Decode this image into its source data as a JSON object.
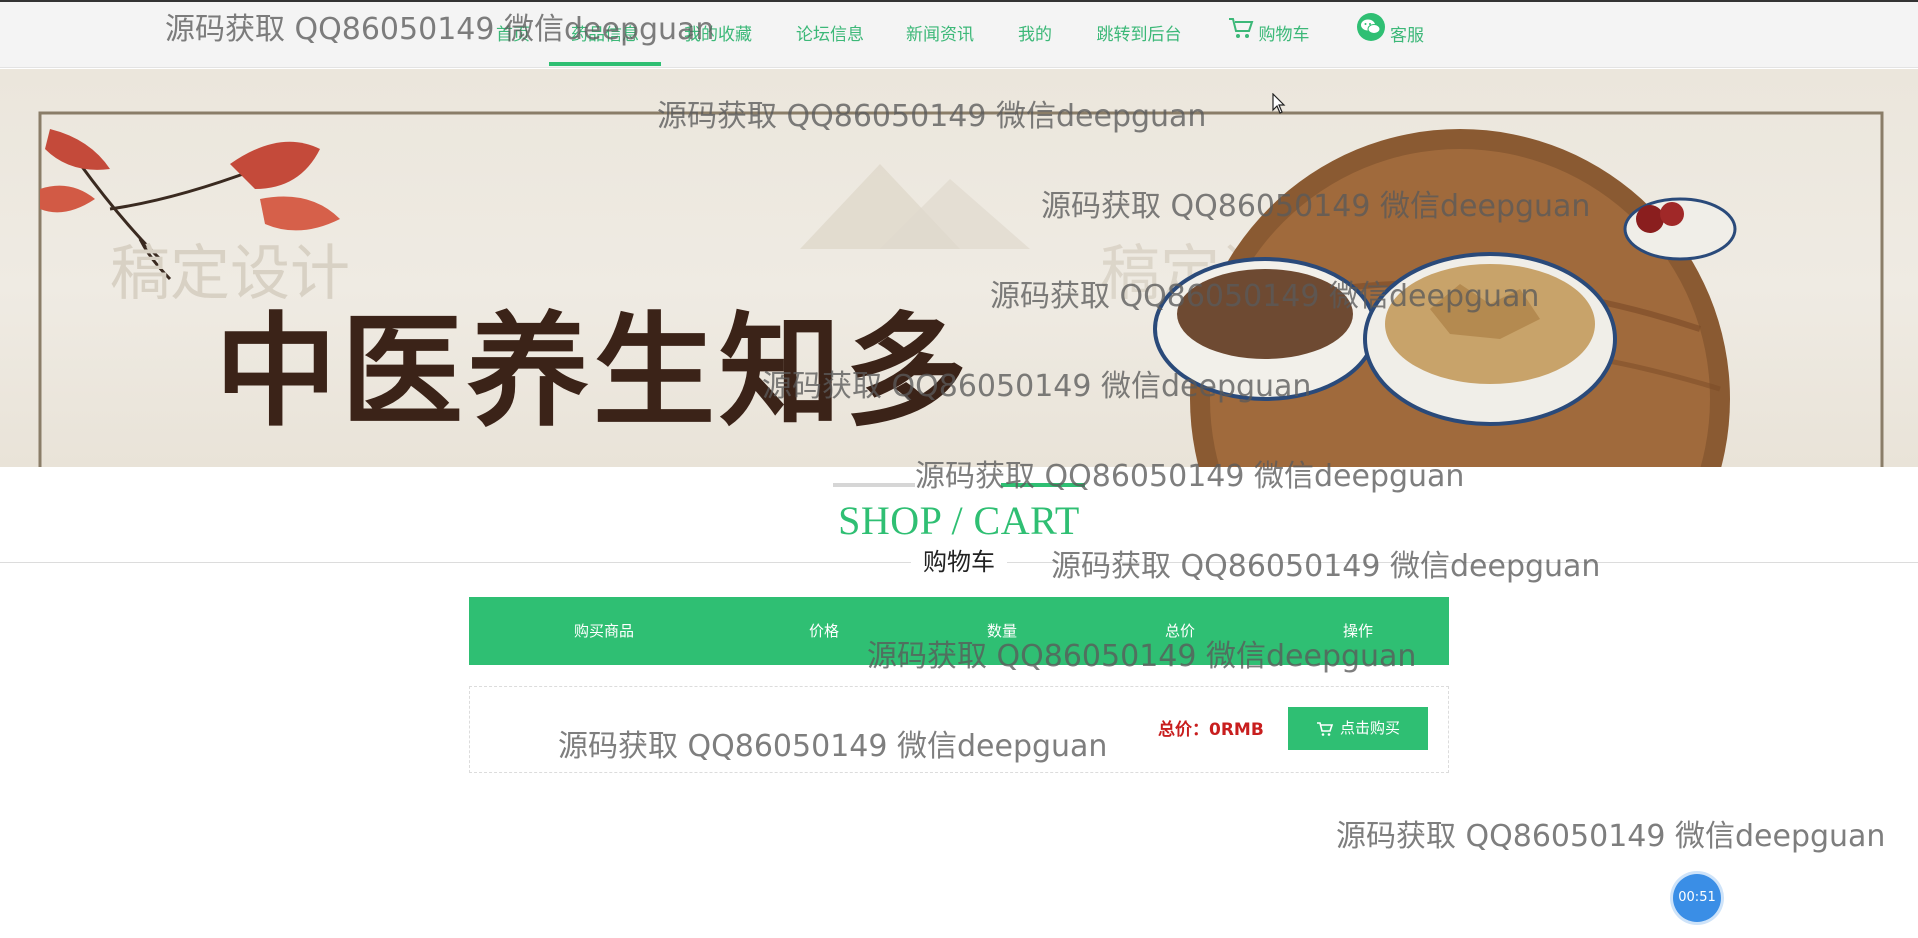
{
  "nav": {
    "items": [
      {
        "label": "首页"
      },
      {
        "label": "药品信息"
      },
      {
        "label": "我的收藏"
      },
      {
        "label": "论坛信息"
      },
      {
        "label": "新闻资讯"
      },
      {
        "label": "我的"
      },
      {
        "label": "跳转到后台"
      },
      {
        "label": "购物车",
        "icon": "cart-icon"
      },
      {
        "label": "客服",
        "icon": "wechat-icon"
      }
    ],
    "active_index": 1
  },
  "banner": {
    "calligraphy": "中医养生知多",
    "faint_text": "稿定设计"
  },
  "section": {
    "title_en": "SHOP / CART",
    "title_cn": "购物车"
  },
  "cart": {
    "columns": [
      "购买商品",
      "价格",
      "数量",
      "总价",
      "操作"
    ],
    "rows": [],
    "total_label": "总价：0RMB",
    "buy_label": "点击购买"
  },
  "timer": {
    "value": "00:51"
  },
  "watermark": {
    "text": "源码获取 QQ86050149 微信deepguan"
  },
  "colors": {
    "accent": "#2fbf73",
    "nav_text": "#3cb878",
    "total_red": "#c81e1e",
    "timer_blue": "#3a8ee6"
  }
}
